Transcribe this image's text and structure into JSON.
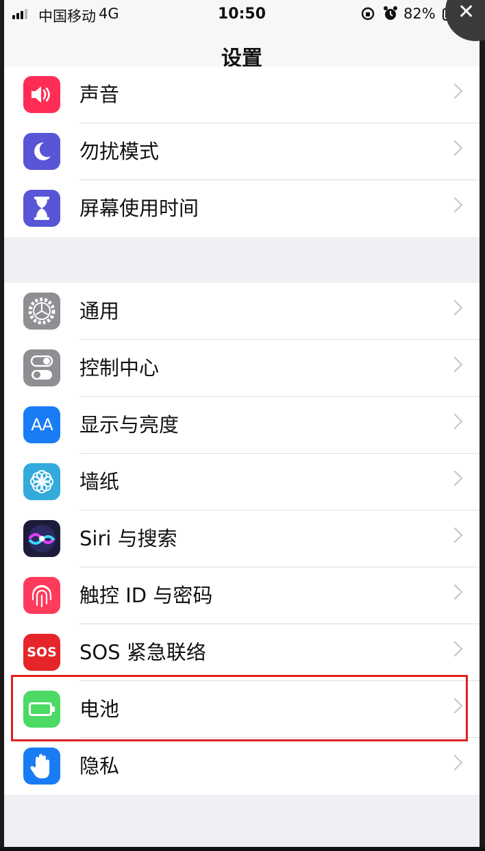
{
  "status_bar": {
    "carrier": "中国移动",
    "network": "4G",
    "time": "10:50",
    "battery_percent": "82%"
  },
  "nav": {
    "title": "设置",
    "close_symbol": "✕"
  },
  "group1": [
    {
      "label": "声音",
      "icon": "speaker-icon",
      "color": "#ff2d55"
    },
    {
      "label": "勿扰模式",
      "icon": "moon-icon",
      "color": "#5856d6"
    },
    {
      "label": "屏幕使用时间",
      "icon": "hourglass-icon",
      "color": "#5856d6"
    }
  ],
  "group2": [
    {
      "label": "通用",
      "icon": "gear-icon",
      "color": "#8e8e93"
    },
    {
      "label": "控制中心",
      "icon": "toggles-icon",
      "color": "#8e8e93"
    },
    {
      "label": "显示与亮度",
      "icon": "text-size-icon",
      "color": "#1a7cf5",
      "glyph": "AA"
    },
    {
      "label": "墙纸",
      "icon": "flower-icon",
      "color": "#34aadc"
    },
    {
      "label": "Siri 与搜索",
      "icon": "siri-icon",
      "color": "#1c1c3a"
    },
    {
      "label": "触控 ID 与密码",
      "icon": "fingerprint-icon",
      "color": "#ff3b5c"
    },
    {
      "label": "SOS 紧急联络",
      "icon": "sos-icon",
      "color": "#e5252a",
      "glyph": "SOS"
    },
    {
      "label": "电池",
      "icon": "battery-icon",
      "color": "#4cd964"
    },
    {
      "label": "隐私",
      "icon": "hand-icon",
      "color": "#1a7cf5"
    }
  ],
  "highlight_color": "#e01f1f"
}
